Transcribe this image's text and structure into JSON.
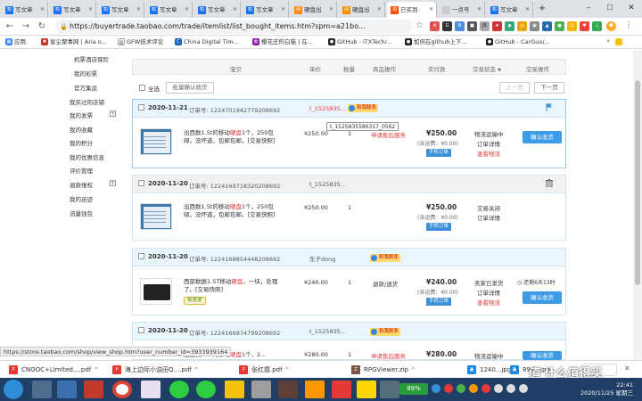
{
  "browser": {
    "tabs": [
      {
        "label": "写文章"
      },
      {
        "label": "写文章"
      },
      {
        "label": "写文章"
      },
      {
        "label": "写文章"
      },
      {
        "label": "写文章"
      },
      {
        "label": "写文章"
      },
      {
        "label": "硬盘出"
      },
      {
        "label": "硬盘出"
      },
      {
        "label": "已买到"
      },
      {
        "label": "一点号"
      },
      {
        "label": "写文章"
      }
    ],
    "url": "https://buyertrade.taobao.com/trade/itemlist/list_bought_items.htm?spm=a21bo...",
    "bookmarks": [
      {
        "label": "应用"
      },
      {
        "label": "星尘聚事网 | Aria o..."
      },
      {
        "label": "GFW技术评论"
      },
      {
        "label": "China Digital Tim..."
      },
      {
        "label": "樱花庄的白猫 | 在..."
      },
      {
        "label": "GitHub - iTXTech/..."
      },
      {
        "label": "如何在github上下..."
      },
      {
        "label": "GitHub - CarGuo/..."
      }
    ]
  },
  "sidebar": [
    {
      "label": "机票酒店保险",
      "sub": true,
      "expand": false
    },
    {
      "label": "我的彩票",
      "sub": true,
      "expand": false
    },
    {
      "label": "官方集运",
      "sub": true,
      "expand": false
    },
    {
      "label": "我买过的店铺",
      "sub": false,
      "expand": false
    },
    {
      "label": "我的发票",
      "sub": false,
      "expand": true
    },
    {
      "label": "我的收藏",
      "sub": false,
      "expand": false
    },
    {
      "label": "我的积分",
      "sub": false,
      "expand": false
    },
    {
      "label": "我的优惠信息",
      "sub": false,
      "expand": false
    },
    {
      "label": "评价管理",
      "sub": false,
      "expand": false
    },
    {
      "label": "退款维权",
      "sub": false,
      "expand": true
    },
    {
      "label": "我的足迹",
      "sub": false,
      "expand": false
    },
    {
      "label": "流量钱包",
      "sub": false,
      "expand": false
    }
  ],
  "table_headers": {
    "item": "宝贝",
    "price": "单价",
    "qty": "数量",
    "ops": "商品操作",
    "paid": "实付款",
    "status": "交易状态",
    "status_caret": "▼",
    "actions": "交易操作"
  },
  "controls": {
    "select_all": "全选",
    "batch_confirm": "批量确认收货",
    "prev_page": "上一页",
    "next_page": "下一页"
  },
  "orders": [
    {
      "date": "2020-11-21",
      "order_no": "订单号: 1224701942779208692",
      "seller": "t_1525835...",
      "contact": "和我联系",
      "desc_pre": "出西数1.5t的移动",
      "desc_hl": "硬盘",
      "desc_post": "1个，250包邮。没坏道，包邮包邮。[交易快照]",
      "price": "¥250.00",
      "qty": "1",
      "op": "申请售后服务",
      "total": "¥250.00",
      "shipping": "(含运费：¥0.00)",
      "phone_order": "手机订单",
      "status1": "物流运输中",
      "status2": "订单详情",
      "status3": "查看物流",
      "action": "确认收货",
      "tooltip": "t_1525835586317_0562"
    },
    {
      "date": "2020-11-20",
      "order_no": "订单号: 1224169718320208692",
      "seller": "t_1525835...",
      "desc_pre": "出西数1.5t的移动",
      "desc_hl": "硬盘",
      "desc_post": "1个，250包邮。没坏道，包邮包邮。[交易快照]",
      "price": "¥250.00",
      "qty": "1",
      "total": "¥250.00",
      "shipping": "(含运费：¥0.00)",
      "phone_order": "手机订单",
      "status1": "交易关闭",
      "status2": "订单详情"
    },
    {
      "date": "2020-11-20",
      "order_no": "订单号: 1224168854448208692",
      "seller": "东子dong",
      "contact": "和我联系",
      "desc_pre": "西部数据1.5T移动",
      "desc_hl": "硬盘",
      "desc_post": "，一块，处理了。[交易快照]",
      "badge": "极速退",
      "price": "¥240.00",
      "qty": "1",
      "op": "退款/退货",
      "total": "¥240.00",
      "shipping": "(含运费：¥0.00)",
      "phone_order": "手机订单",
      "status1": "卖家已发货",
      "status2": "订单详情",
      "status3": "查看物流",
      "remaining": "还剩6天13时",
      "action": "确认收货"
    },
    {
      "date": "2020-11-20",
      "order_no": "订单号: 1224166874799208692",
      "seller": "t_1525835...",
      "contact": "和我联系",
      "desc_pre": "出西数1.5t的移动",
      "desc_hl": "硬盘",
      "desc_post": "1个，2...",
      "price": "¥280.00",
      "qty": "1",
      "op": "申请售后服务",
      "total": "¥280.00",
      "status1": "物流运输中",
      "action": "确认收货"
    }
  ],
  "status_url": "https://store.taobao.com/shop/view_shop.htm?user_number_id=3933939164",
  "downloads": [
    {
      "label": "CNOOC+Limited....pdf"
    },
    {
      "label": "海上边际小油田Q....pdf"
    },
    {
      "label": "张红霞.pdf"
    },
    {
      "label": "RPGViewer.zip"
    },
    {
      "label": "1240...jpg"
    },
    {
      "label": "894...jpg"
    }
  ],
  "taskbar": {
    "battery": "89%",
    "time": "22:41",
    "date": "2020/11/25 星期三"
  },
  "watermark": "值 什么值得买"
}
